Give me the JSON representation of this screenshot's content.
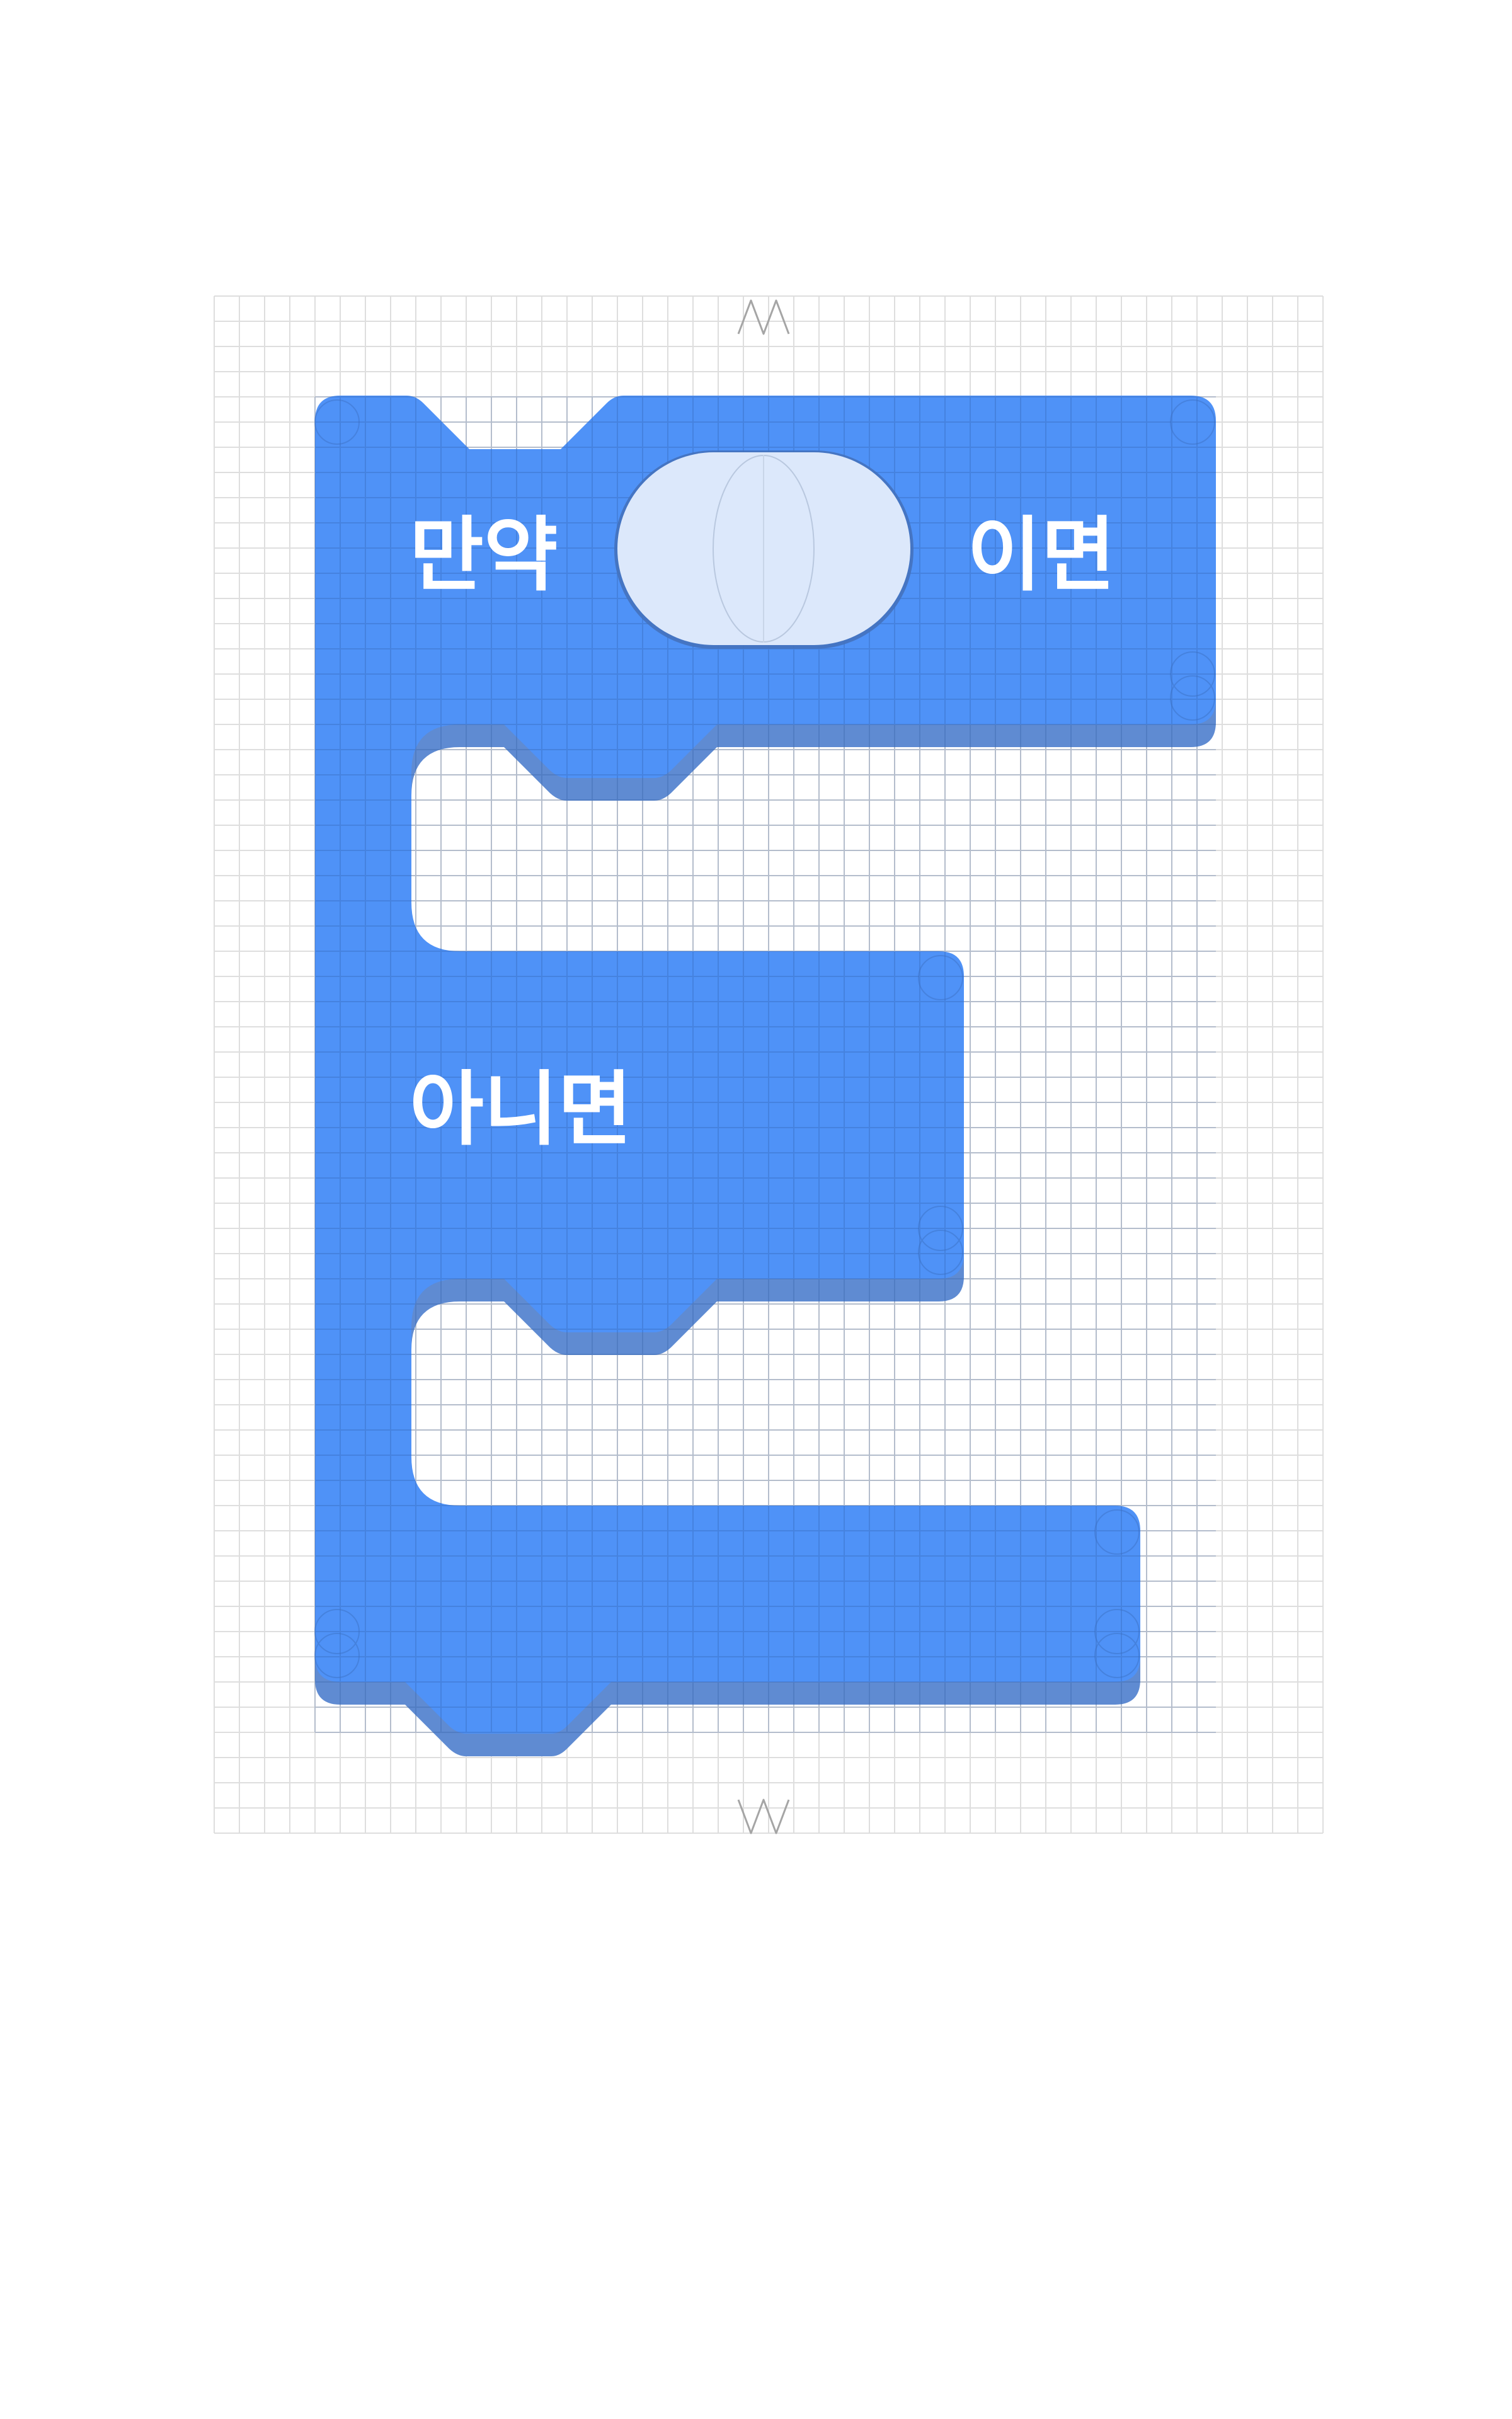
{
  "block": {
    "type": "if-else",
    "if_label": "만약",
    "then_label": "이면",
    "else_label": "아니면",
    "condition_slot": "empty"
  },
  "colors": {
    "block_fill": "#4f92f7",
    "block_shadow": "#5f8bd2",
    "slot_fill": "#dce8fb",
    "slot_stroke": "#4472bd",
    "grid_line": "#dedede",
    "guide_stroke": "#a5a5a5"
  }
}
